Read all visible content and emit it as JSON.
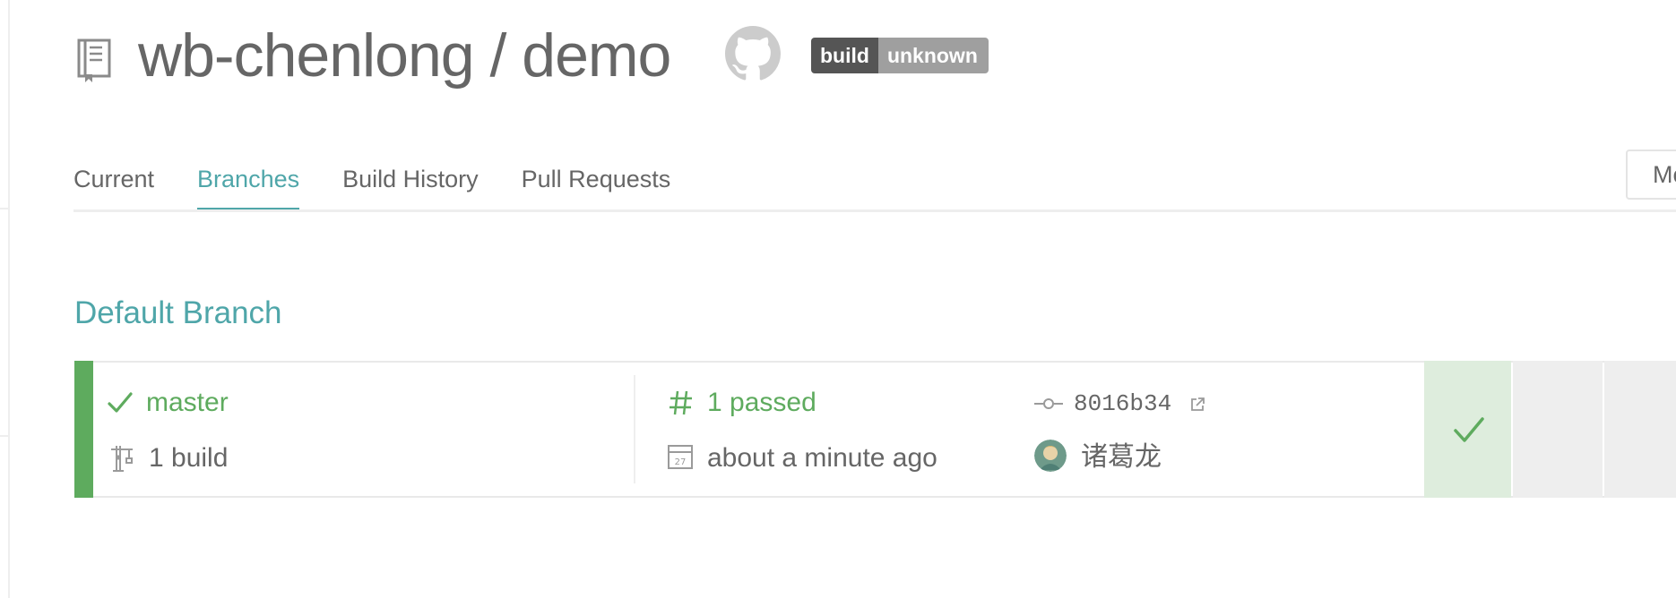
{
  "header": {
    "repo_title": "wb-chenlong / demo",
    "badge": {
      "left": "build",
      "right": "unknown"
    }
  },
  "tabs": [
    {
      "label": "Current",
      "active": false
    },
    {
      "label": "Branches",
      "active": true
    },
    {
      "label": "Build History",
      "active": false
    },
    {
      "label": "Pull Requests",
      "active": false
    }
  ],
  "more_button": {
    "label": "Mo"
  },
  "section": {
    "title": "Default Branch"
  },
  "branch": {
    "name": "master",
    "builds": "1 build",
    "build_status": "1 passed",
    "time": "about a minute ago",
    "commit": "8016b34",
    "author": "诸葛龙",
    "status": "passed"
  },
  "colors": {
    "accent": "#4fa6a9",
    "passed": "#5eab5e",
    "passed_tile": "#deeddd",
    "badge_dark": "#555555",
    "badge_light": "#9f9f9f"
  },
  "icons": {
    "repo": "repo-book-icon",
    "github": "github-icon",
    "branch_status": "checkmark-icon",
    "builds": "crane-icon",
    "build_number": "hash-icon",
    "calendar": "calendar-icon",
    "commit": "commit-icon",
    "external": "external-link-icon"
  }
}
